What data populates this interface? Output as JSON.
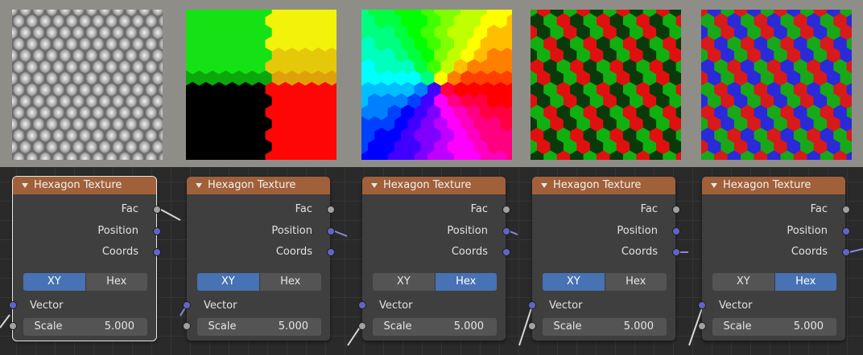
{
  "previews": [
    {
      "name": "fac-preview",
      "mode": "grayscale"
    },
    {
      "name": "position-xy-preview",
      "mode": "quadrant-rg"
    },
    {
      "name": "position-hex-preview",
      "mode": "hex-hue"
    },
    {
      "name": "coords-xy-preview",
      "mode": "cube-rgb"
    },
    {
      "name": "coords-hex-preview",
      "mode": "tri-rgb"
    }
  ],
  "nodes": [
    {
      "title": "Hexagon Texture",
      "outputs": [
        "Fac",
        "Position",
        "Coords"
      ],
      "modes": [
        "XY",
        "Hex"
      ],
      "active_mode": "XY",
      "input": "Vector",
      "scale_label": "Scale",
      "scale_value": "5.000",
      "selected": true
    },
    {
      "title": "Hexagon Texture",
      "outputs": [
        "Fac",
        "Position",
        "Coords"
      ],
      "modes": [
        "XY",
        "Hex"
      ],
      "active_mode": "XY",
      "input": "Vector",
      "scale_label": "Scale",
      "scale_value": "5.000",
      "selected": false
    },
    {
      "title": "Hexagon Texture",
      "outputs": [
        "Fac",
        "Position",
        "Coords"
      ],
      "modes": [
        "XY",
        "Hex"
      ],
      "active_mode": "Hex",
      "input": "Vector",
      "scale_label": "Scale",
      "scale_value": "5.000",
      "selected": false
    },
    {
      "title": "Hexagon Texture",
      "outputs": [
        "Fac",
        "Position",
        "Coords"
      ],
      "modes": [
        "XY",
        "Hex"
      ],
      "active_mode": "XY",
      "input": "Vector",
      "scale_label": "Scale",
      "scale_value": "5.000",
      "selected": false
    },
    {
      "title": "Hexagon Texture",
      "outputs": [
        "Fac",
        "Position",
        "Coords"
      ],
      "modes": [
        "XY",
        "Hex"
      ],
      "active_mode": "Hex",
      "input": "Vector",
      "scale_label": "Scale",
      "scale_value": "5.000",
      "selected": false
    }
  ],
  "colors": {
    "header": "#a0603a",
    "active_toggle": "#4772b3",
    "socket_float": "#a1a1a1",
    "socket_vector": "#6363c7"
  }
}
